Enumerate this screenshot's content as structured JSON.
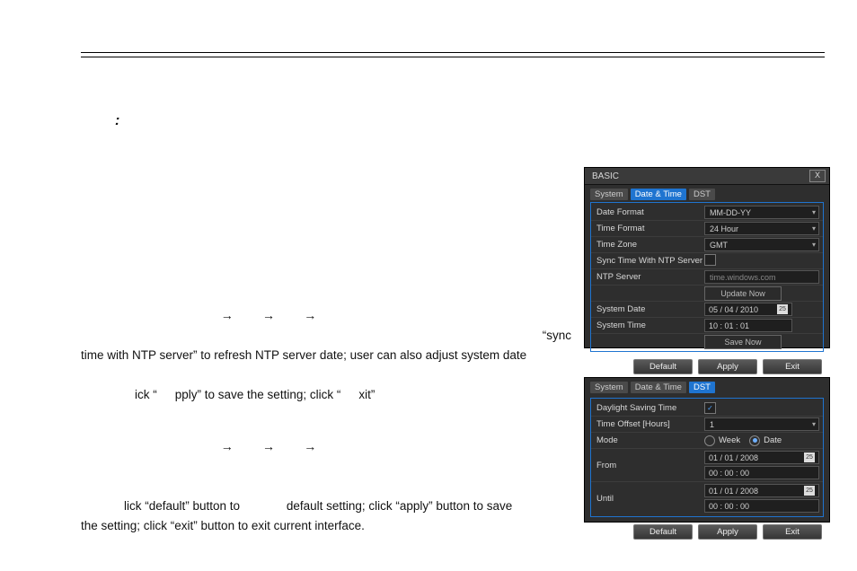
{
  "colon": ":",
  "arrows": {
    "a": "→"
  },
  "body_line2": "“sync",
  "body_line3": "time with NTP server” to refresh NTP server date; user can also adjust system date",
  "body_line4_pre": "ick “",
  "body_line4_mid": "pply” to save the setting; click “",
  "body_line4_end": "xit”",
  "body2_line2_pre": "lick “default” button to",
  "body2_line2_mid": "default setting; click “apply” button to save",
  "body2_line3": "the setting; click “exit” button to exit current interface.",
  "dlg1": {
    "title": "BASIC",
    "close": "X",
    "tabs": {
      "system": "System",
      "datetime": "Date & Time",
      "dst": "DST"
    },
    "labels": {
      "date_format": "Date Format",
      "time_format": "Time Format",
      "time_zone": "Time Zone",
      "sync_ntp": "Sync Time With NTP Server",
      "ntp_server": "NTP Server",
      "system_date": "System Date",
      "system_time": "System Time"
    },
    "values": {
      "date_format": "MM-DD-YY",
      "time_format": "24 Hour",
      "time_zone": "GMT",
      "ntp_server": "time.windows.com",
      "system_date": "05 / 04 / 2010",
      "system_time": "10 : 01 : 01"
    },
    "buttons": {
      "update_now": "Update Now",
      "save_now": "Save Now",
      "default": "Default",
      "apply": "Apply",
      "exit": "Exit"
    },
    "cal_icon": "25"
  },
  "dlg2": {
    "tabs": {
      "system": "System",
      "datetime": "Date & Time",
      "dst": "DST"
    },
    "labels": {
      "dst": "Daylight Saving Time",
      "offset": "Time Offset [Hours]",
      "mode": "Mode",
      "from": "From",
      "until": "Until"
    },
    "values": {
      "offset": "1",
      "mode_week": "Week",
      "mode_date": "Date",
      "from_date": "01 / 01 / 2008",
      "from_time": "00 : 00 : 00",
      "until_date": "01 / 01 / 2008",
      "until_time": "00 : 00 : 00"
    },
    "check": "✓",
    "buttons": {
      "default": "Default",
      "apply": "Apply",
      "exit": "Exit"
    },
    "cal_icon": "25"
  }
}
